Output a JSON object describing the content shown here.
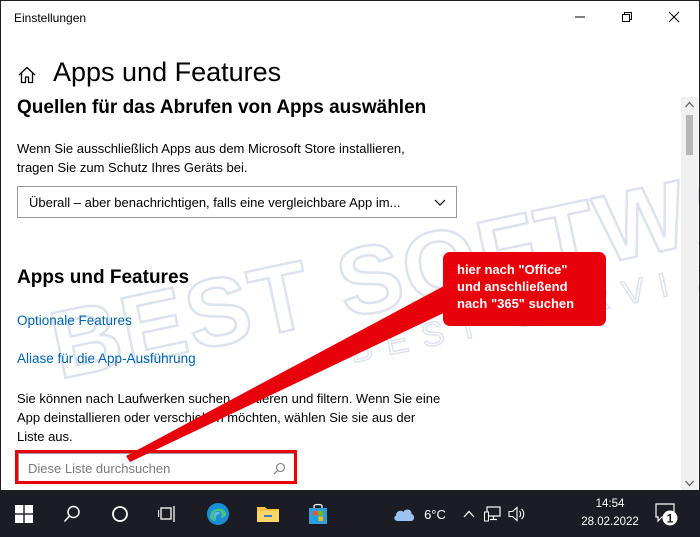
{
  "window": {
    "title": "Einstellungen",
    "page_title": "Apps und Features"
  },
  "section_sources": {
    "title": "Quellen für das Abrufen von Apps auswählen",
    "desc_line1": "Wenn Sie ausschließlich Apps aus dem Microsoft Store installieren,",
    "desc_line2": "tragen Sie zum Schutz Ihres Geräts bei.",
    "dropdown_value": "Überall – aber benachrichtigen, falls eine vergleichbare App im..."
  },
  "section_apps": {
    "title": "Apps und Features",
    "link_optional": "Optionale Features",
    "link_alias": "Aliase für die App-Ausführung",
    "desc_line1": "Sie können nach Laufwerken suchen, sortieren und filtern. Wenn Sie eine",
    "desc_line2": "App deinstallieren oder verschieben möchten, wählen Sie sie aus der",
    "desc_line3": "Liste aus.",
    "search_placeholder": "Diese Liste durchsuchen"
  },
  "annotation": {
    "line1": "hier nach \"Office\"",
    "line2": "und anschließend",
    "line3": "nach \"365\" suchen",
    "color": "#e8000b"
  },
  "watermark": {
    "big": "BEST SOFTWARE",
    "small": "BEST SERVICE",
    "color": "#dde3ee"
  },
  "taskbar": {
    "weather_temp": "6°C",
    "time": "14:54",
    "date": "28.02.2022",
    "notification_count": "1",
    "background": "#1c1c24"
  },
  "colors": {
    "link": "#0063b1"
  }
}
